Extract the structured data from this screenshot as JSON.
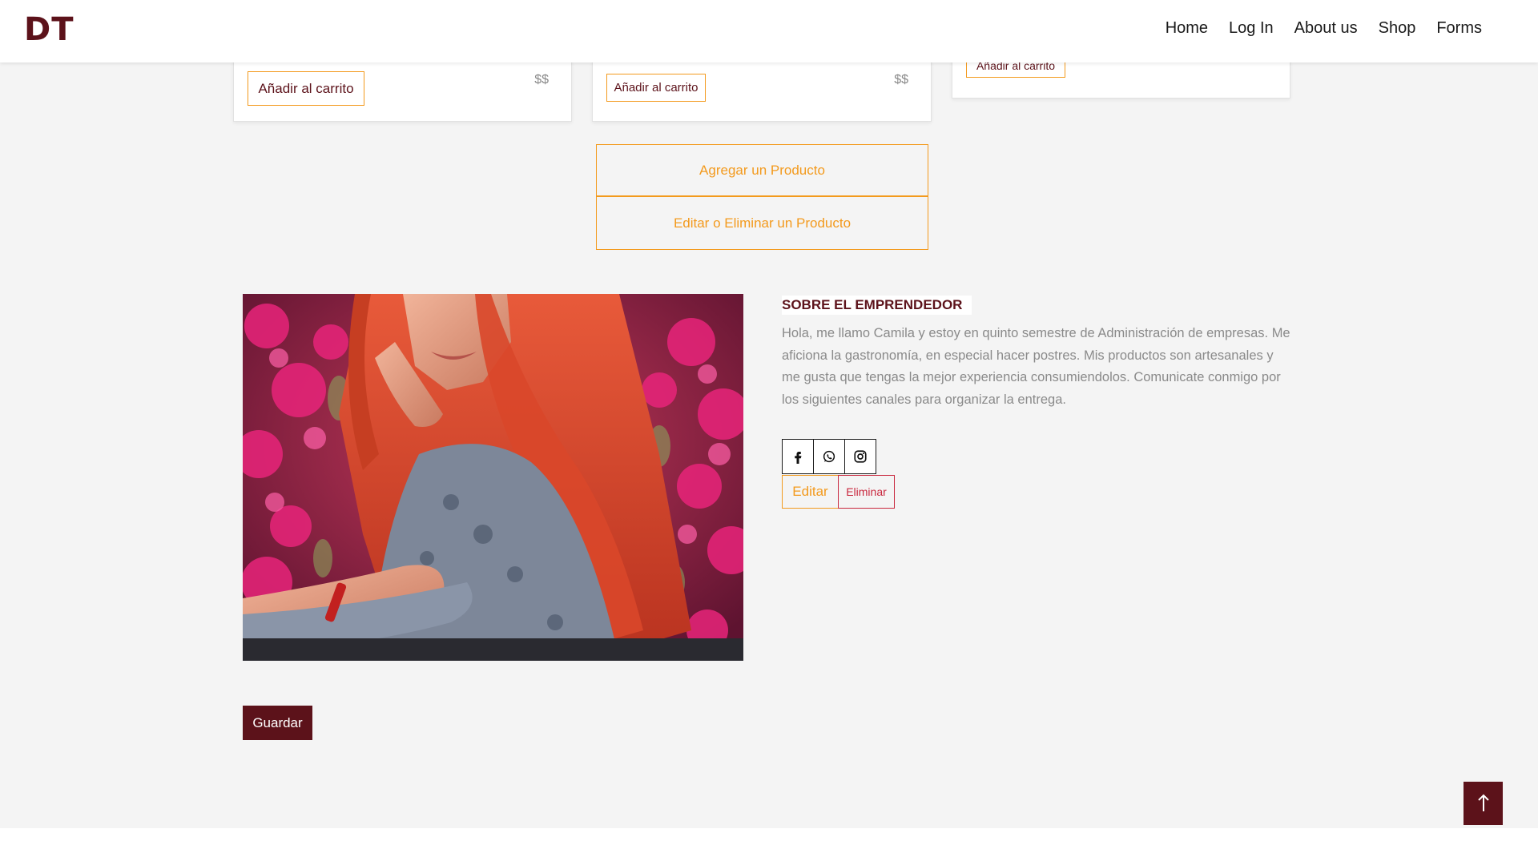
{
  "brand": "DT",
  "nav": {
    "home": "Home",
    "login": "Log In",
    "about": "About us",
    "shop": "Shop",
    "forms": "Forms"
  },
  "products": [
    {
      "cart_label": "Añadir al carrito",
      "price": "$$"
    },
    {
      "cart_label": "Añadir al carrito",
      "price": "$$"
    },
    {
      "cart_label": "Añadir al carrito",
      "price": "$$"
    }
  ],
  "admin": {
    "add_product": "Agregar un Producto",
    "edit_delete_product": "Editar o Eliminar un Producto"
  },
  "about": {
    "title": "SOBRE EL EMPRENDEDOR",
    "text": "Hola, me llamo Camila y estoy en quinto semestre de Administración de empresas. Me aficiona la gastronomía, en especial hacer postres. Mis productos son artesanales y me gusta que tengas la mejor experiencia consumiendolos. Comunicate conmigo por los siguientes canales para organizar la entrega.",
    "edit_label": "Editar",
    "delete_label": "Eliminar"
  },
  "social_icons": [
    "facebook-icon",
    "whatsapp-icon",
    "instagram-icon"
  ],
  "save_label": "Guardar",
  "colors": {
    "brand": "#5c121a",
    "accent": "#f39a1d",
    "danger": "#c9283e",
    "background": "#f4f4f4"
  }
}
